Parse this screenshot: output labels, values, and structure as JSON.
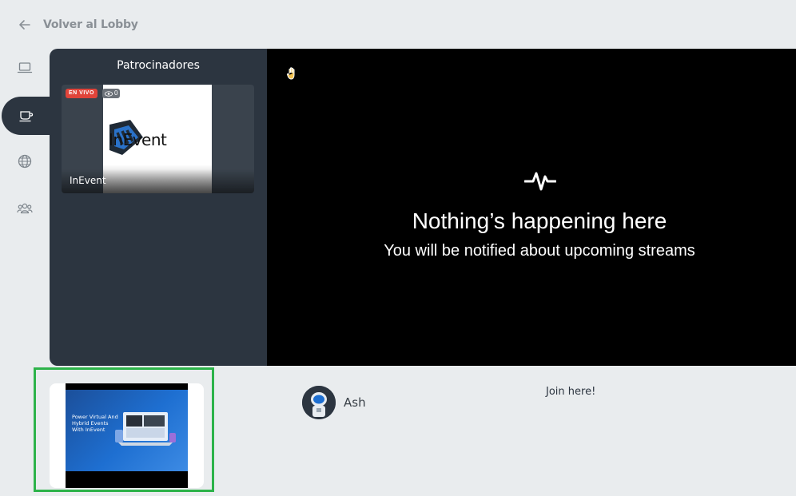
{
  "header": {
    "back_label": "Volver al Lobby",
    "back_icon": "arrow-left-icon"
  },
  "rail": {
    "items": [
      {
        "name": "laptop",
        "icon": "laptop-icon",
        "active": false
      },
      {
        "name": "coffee",
        "icon": "coffee-cup-icon",
        "active": true
      },
      {
        "name": "globe",
        "icon": "globe-icon",
        "active": false
      },
      {
        "name": "people",
        "icon": "people-icon",
        "active": false
      }
    ]
  },
  "sponsors": {
    "title": "Patrocinadores",
    "cards": [
      {
        "name": "InEvent",
        "logo_text": "InEvent",
        "live_label": "EN VIVO",
        "viewers": "0"
      }
    ]
  },
  "stage": {
    "headline": "Nothing’s happening here",
    "subtext": "You will be notified about upcoming streams"
  },
  "thumbnail": {
    "slide_text": "Power Virtual And Hybrid Events With InEvent"
  },
  "host": {
    "name": "Ash"
  },
  "join": {
    "label": "Join here!"
  },
  "colors": {
    "accent_green": "#2db34a",
    "panel": "#2c3540",
    "live_red": "#e0443a"
  }
}
